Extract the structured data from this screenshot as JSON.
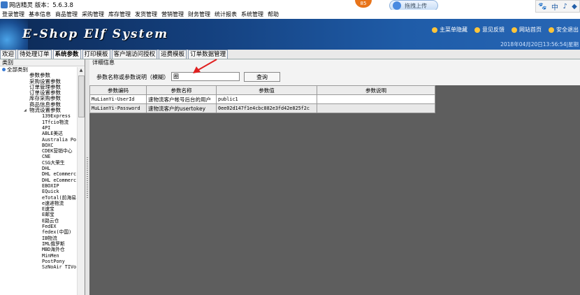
{
  "window": {
    "title": "网店精灵 版本：5.6.3.8"
  },
  "overlay": {
    "badge": "85",
    "upload_label": "拖拽上传"
  },
  "tray": {
    "items": [
      "🐾",
      "中",
      "♪",
      "◆"
    ]
  },
  "menu": [
    "登录管理",
    "基本信息",
    "商品管理",
    "采购管理",
    "库存管理",
    "发货管理",
    "营销管理",
    "财务管理",
    "统计报表",
    "系统管理",
    "帮助"
  ],
  "banner": {
    "logo": "E-Shop Elf System",
    "links": [
      "主菜单隐藏",
      "意见反馈",
      "网站首页",
      "安全退出"
    ],
    "datetime": "2018年04月20日13:56:54|星期"
  },
  "tabs": [
    {
      "label": "欢迎",
      "active": false
    },
    {
      "label": "待处理订单",
      "active": false
    },
    {
      "label": "系统参数",
      "active": true
    },
    {
      "label": "打印模板",
      "active": false
    },
    {
      "label": "客户端访问授权",
      "active": false
    },
    {
      "label": "运费模板",
      "active": false
    },
    {
      "label": "订单数据管理",
      "active": false
    }
  ],
  "left": {
    "header": "类别",
    "root": "全部类别",
    "groups": [
      "参数参数",
      "采购设置参数",
      "订单管理参数",
      "订单设置参数",
      "库存采购参数",
      "商品信息参数",
      "物流设置参数"
    ],
    "carriers": [
      "139Express",
      "1Tfcio物流",
      "4PI",
      "ABLE美达",
      "Australia Po",
      "BOXC",
      "CDEK营销中心",
      "CNE",
      "CSG大荣生",
      "DHL",
      "DHL eCommerc",
      "DHL eCommerc",
      "EBOXIP",
      "EQuick",
      "eTotal(前海易",
      "e速递物流",
      "E速宝",
      "E邮宝",
      "E路云仓",
      "FedEX",
      "fedex(中国)",
      "IB物流",
      "IML俄罗斯",
      "MBD海外仓",
      "MinMen",
      "PostPony",
      "SzNoAir TIVo"
    ]
  },
  "right": {
    "header": "详细信息",
    "search": {
      "label": "参数名称或参数说明（模糊）",
      "value": "圈",
      "button": "查询"
    },
    "columns": [
      "参数编码",
      "参数名称",
      "参数值",
      "参数说明"
    ],
    "rows": [
      {
        "code": "MuLianYi-UserId",
        "name": "速物流客户帐号后台的用户",
        "value": "public1",
        "desc": ""
      },
      {
        "code": "MuLianYi-Password",
        "name": "速物流客户的usertokey",
        "value": "0ee02d147f1e4cbc882e3fd42e825f2c",
        "desc": ""
      }
    ]
  }
}
